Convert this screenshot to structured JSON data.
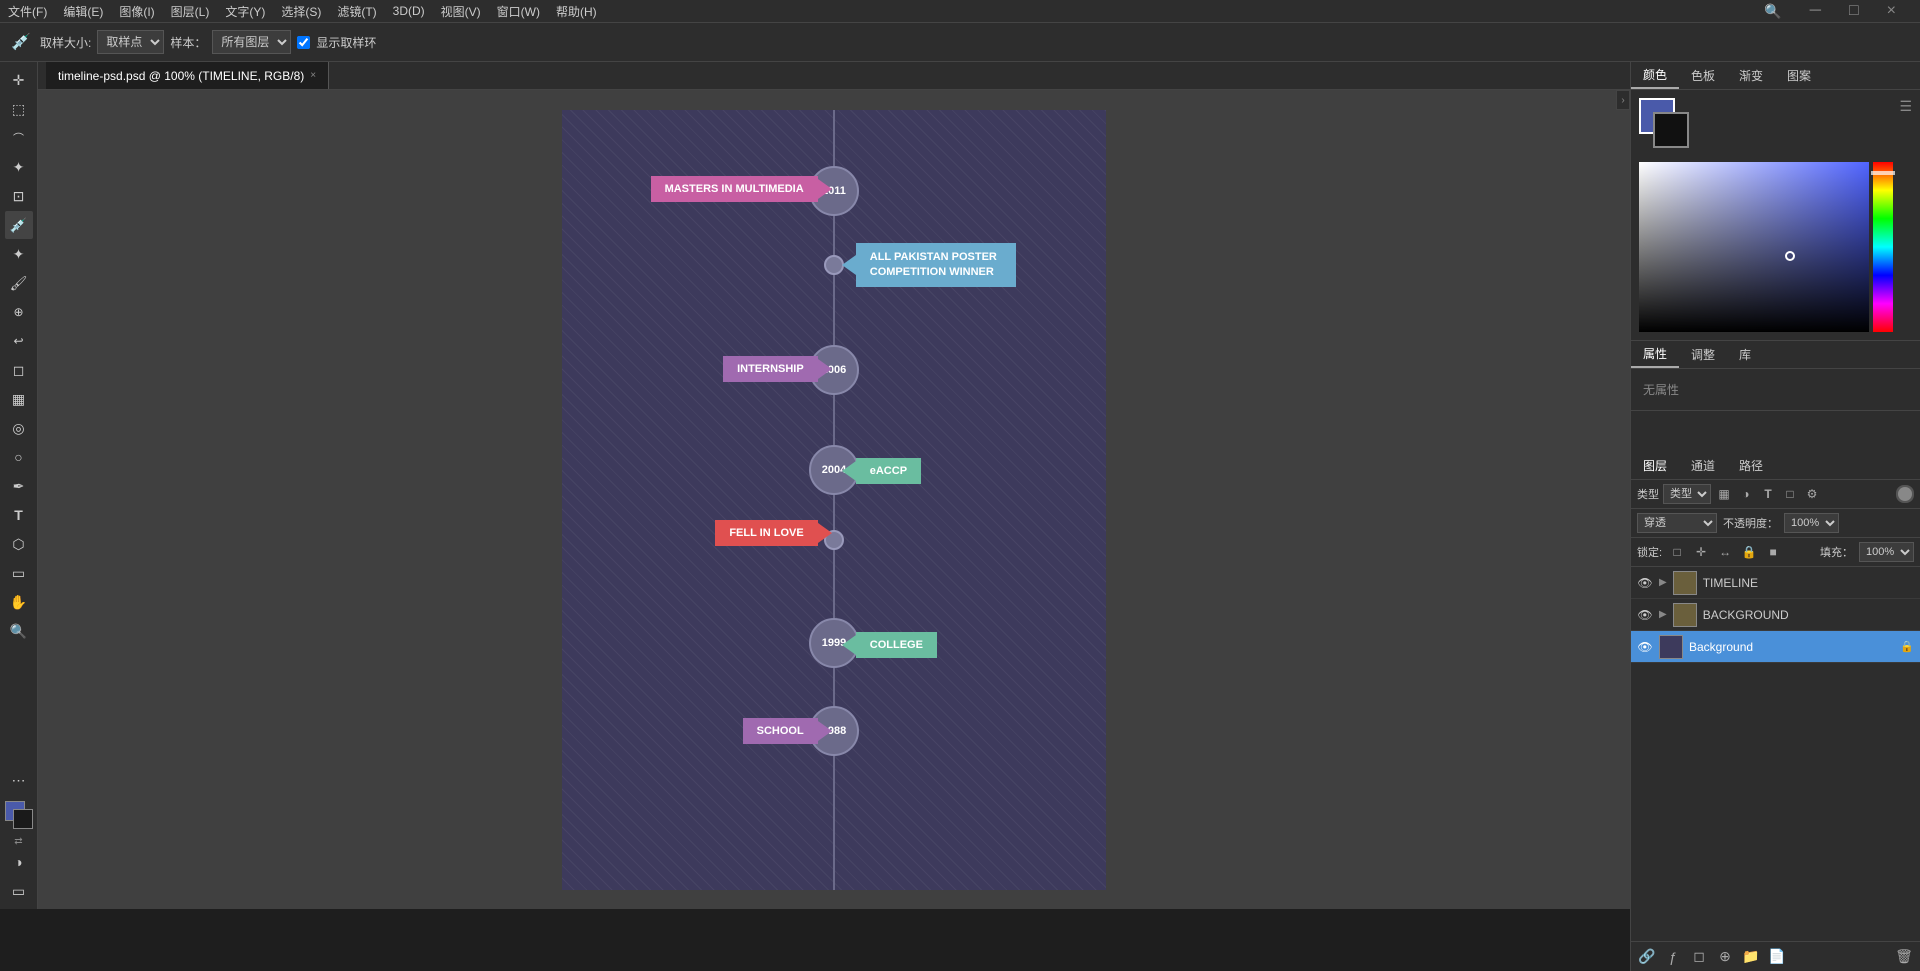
{
  "window": {
    "title": "timeline-psd.psd @ 100% (TIMELINE, RGB/8)",
    "tab_close": "×"
  },
  "menubar": {
    "items": [
      "文件(F)",
      "编辑(E)",
      "图像(I)",
      "图层(L)",
      "文字(Y)",
      "选择(S)",
      "滤镜(T)",
      "3D(D)",
      "视图(V)",
      "窗口(W)",
      "帮助(H)"
    ]
  },
  "toolbar": {
    "eyedropper_label": "取样大小:",
    "eyedropper_value": "取样点",
    "sample_label": "样本：",
    "sample_value": "所有图层",
    "show_ring_label": "显示取样环",
    "search_icon": "🔍",
    "search2_icon": "□",
    "settings_icon": "..."
  },
  "color_panel": {
    "tabs": [
      "颜色",
      "色板",
      "渐变",
      "图案"
    ],
    "active_tab": "颜色"
  },
  "properties": {
    "tabs": [
      "属性",
      "调整",
      "库"
    ],
    "active_tab": "属性",
    "no_properties": "无属性"
  },
  "layers_panel": {
    "tabs": [
      "图层",
      "通道",
      "路径"
    ],
    "active_tab": "图层",
    "filter_label": "类型",
    "blend_mode": "穿透",
    "opacity_label": "不透明度：",
    "opacity_value": "100%",
    "fill_label": "填充：",
    "fill_value": "100%",
    "lock_label": "锁定:",
    "lock_icons": [
      "□",
      "✛",
      "↔",
      "🔒",
      "■"
    ],
    "layers": [
      {
        "name": "TIMELINE",
        "type": "folder",
        "visible": true,
        "locked": false
      },
      {
        "name": "BACKGROUND",
        "type": "folder",
        "visible": true,
        "locked": false
      },
      {
        "name": "Background",
        "type": "layer",
        "visible": true,
        "locked": true
      }
    ]
  },
  "timeline": {
    "events": [
      {
        "year": "2011",
        "label": "MASTERS IN MULTIMEDIA",
        "side": "left",
        "color": "#c85fa3",
        "type": "node"
      },
      {
        "year": "",
        "label": "ALL PAKISTAN POSTER COMPETITION WINNER",
        "side": "right",
        "color": "#6aacce",
        "type": "dot"
      },
      {
        "year": "2006",
        "label": "INTERNSHIP",
        "side": "left",
        "color": "#a06ab0",
        "type": "node"
      },
      {
        "year": "2004",
        "label": "eACCP",
        "side": "right",
        "color": "#6abda0",
        "type": "node"
      },
      {
        "year": "",
        "label": "FELL IN LOVE",
        "side": "left",
        "color": "#e05050",
        "type": "dot"
      },
      {
        "year": "1999",
        "label": "COLLEGE",
        "side": "right",
        "color": "#6abda0",
        "type": "node"
      },
      {
        "year": "1988",
        "label": "SCHOOL",
        "side": "left",
        "color": "#a06ab0",
        "type": "node"
      }
    ]
  }
}
